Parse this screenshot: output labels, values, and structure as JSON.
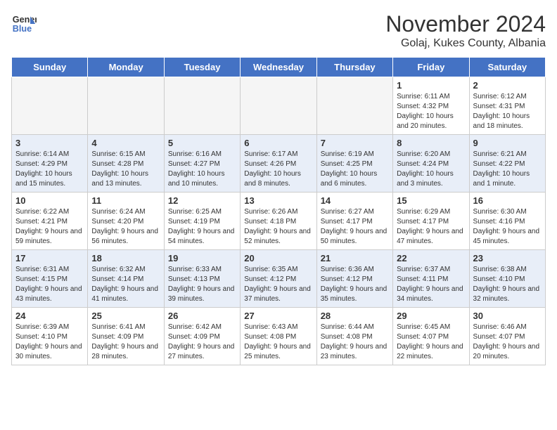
{
  "logo": {
    "line1": "General",
    "line2": "Blue"
  },
  "title": "November 2024",
  "subtitle": "Golaj, Kukes County, Albania",
  "days_of_week": [
    "Sunday",
    "Monday",
    "Tuesday",
    "Wednesday",
    "Thursday",
    "Friday",
    "Saturday"
  ],
  "rows": [
    {
      "cells": [
        {
          "empty": true
        },
        {
          "empty": true
        },
        {
          "empty": true
        },
        {
          "empty": true
        },
        {
          "empty": true
        },
        {
          "day": "1",
          "sunrise": "Sunrise: 6:11 AM",
          "sunset": "Sunset: 4:32 PM",
          "daylight": "Daylight: 10 hours and 20 minutes."
        },
        {
          "day": "2",
          "sunrise": "Sunrise: 6:12 AM",
          "sunset": "Sunset: 4:31 PM",
          "daylight": "Daylight: 10 hours and 18 minutes."
        }
      ]
    },
    {
      "cells": [
        {
          "day": "3",
          "sunrise": "Sunrise: 6:14 AM",
          "sunset": "Sunset: 4:29 PM",
          "daylight": "Daylight: 10 hours and 15 minutes."
        },
        {
          "day": "4",
          "sunrise": "Sunrise: 6:15 AM",
          "sunset": "Sunset: 4:28 PM",
          "daylight": "Daylight: 10 hours and 13 minutes."
        },
        {
          "day": "5",
          "sunrise": "Sunrise: 6:16 AM",
          "sunset": "Sunset: 4:27 PM",
          "daylight": "Daylight: 10 hours and 10 minutes."
        },
        {
          "day": "6",
          "sunrise": "Sunrise: 6:17 AM",
          "sunset": "Sunset: 4:26 PM",
          "daylight": "Daylight: 10 hours and 8 minutes."
        },
        {
          "day": "7",
          "sunrise": "Sunrise: 6:19 AM",
          "sunset": "Sunset: 4:25 PM",
          "daylight": "Daylight: 10 hours and 6 minutes."
        },
        {
          "day": "8",
          "sunrise": "Sunrise: 6:20 AM",
          "sunset": "Sunset: 4:24 PM",
          "daylight": "Daylight: 10 hours and 3 minutes."
        },
        {
          "day": "9",
          "sunrise": "Sunrise: 6:21 AM",
          "sunset": "Sunset: 4:22 PM",
          "daylight": "Daylight: 10 hours and 1 minute."
        }
      ]
    },
    {
      "cells": [
        {
          "day": "10",
          "sunrise": "Sunrise: 6:22 AM",
          "sunset": "Sunset: 4:21 PM",
          "daylight": "Daylight: 9 hours and 59 minutes."
        },
        {
          "day": "11",
          "sunrise": "Sunrise: 6:24 AM",
          "sunset": "Sunset: 4:20 PM",
          "daylight": "Daylight: 9 hours and 56 minutes."
        },
        {
          "day": "12",
          "sunrise": "Sunrise: 6:25 AM",
          "sunset": "Sunset: 4:19 PM",
          "daylight": "Daylight: 9 hours and 54 minutes."
        },
        {
          "day": "13",
          "sunrise": "Sunrise: 6:26 AM",
          "sunset": "Sunset: 4:18 PM",
          "daylight": "Daylight: 9 hours and 52 minutes."
        },
        {
          "day": "14",
          "sunrise": "Sunrise: 6:27 AM",
          "sunset": "Sunset: 4:17 PM",
          "daylight": "Daylight: 9 hours and 50 minutes."
        },
        {
          "day": "15",
          "sunrise": "Sunrise: 6:29 AM",
          "sunset": "Sunset: 4:17 PM",
          "daylight": "Daylight: 9 hours and 47 minutes."
        },
        {
          "day": "16",
          "sunrise": "Sunrise: 6:30 AM",
          "sunset": "Sunset: 4:16 PM",
          "daylight": "Daylight: 9 hours and 45 minutes."
        }
      ]
    },
    {
      "cells": [
        {
          "day": "17",
          "sunrise": "Sunrise: 6:31 AM",
          "sunset": "Sunset: 4:15 PM",
          "daylight": "Daylight: 9 hours and 43 minutes."
        },
        {
          "day": "18",
          "sunrise": "Sunrise: 6:32 AM",
          "sunset": "Sunset: 4:14 PM",
          "daylight": "Daylight: 9 hours and 41 minutes."
        },
        {
          "day": "19",
          "sunrise": "Sunrise: 6:33 AM",
          "sunset": "Sunset: 4:13 PM",
          "daylight": "Daylight: 9 hours and 39 minutes."
        },
        {
          "day": "20",
          "sunrise": "Sunrise: 6:35 AM",
          "sunset": "Sunset: 4:12 PM",
          "daylight": "Daylight: 9 hours and 37 minutes."
        },
        {
          "day": "21",
          "sunrise": "Sunrise: 6:36 AM",
          "sunset": "Sunset: 4:12 PM",
          "daylight": "Daylight: 9 hours and 35 minutes."
        },
        {
          "day": "22",
          "sunrise": "Sunrise: 6:37 AM",
          "sunset": "Sunset: 4:11 PM",
          "daylight": "Daylight: 9 hours and 34 minutes."
        },
        {
          "day": "23",
          "sunrise": "Sunrise: 6:38 AM",
          "sunset": "Sunset: 4:10 PM",
          "daylight": "Daylight: 9 hours and 32 minutes."
        }
      ]
    },
    {
      "cells": [
        {
          "day": "24",
          "sunrise": "Sunrise: 6:39 AM",
          "sunset": "Sunset: 4:10 PM",
          "daylight": "Daylight: 9 hours and 30 minutes."
        },
        {
          "day": "25",
          "sunrise": "Sunrise: 6:41 AM",
          "sunset": "Sunset: 4:09 PM",
          "daylight": "Daylight: 9 hours and 28 minutes."
        },
        {
          "day": "26",
          "sunrise": "Sunrise: 6:42 AM",
          "sunset": "Sunset: 4:09 PM",
          "daylight": "Daylight: 9 hours and 27 minutes."
        },
        {
          "day": "27",
          "sunrise": "Sunrise: 6:43 AM",
          "sunset": "Sunset: 4:08 PM",
          "daylight": "Daylight: 9 hours and 25 minutes."
        },
        {
          "day": "28",
          "sunrise": "Sunrise: 6:44 AM",
          "sunset": "Sunset: 4:08 PM",
          "daylight": "Daylight: 9 hours and 23 minutes."
        },
        {
          "day": "29",
          "sunrise": "Sunrise: 6:45 AM",
          "sunset": "Sunset: 4:07 PM",
          "daylight": "Daylight: 9 hours and 22 minutes."
        },
        {
          "day": "30",
          "sunrise": "Sunrise: 6:46 AM",
          "sunset": "Sunset: 4:07 PM",
          "daylight": "Daylight: 9 hours and 20 minutes."
        }
      ]
    }
  ]
}
